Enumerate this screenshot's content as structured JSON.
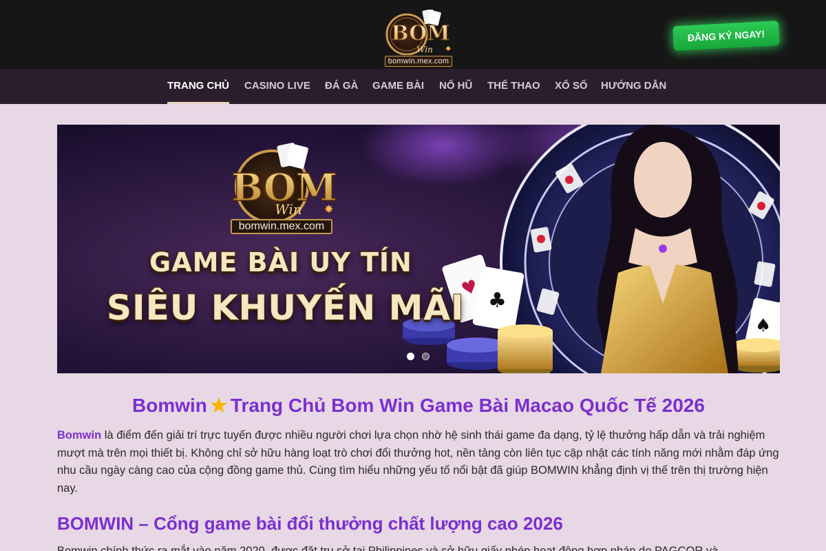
{
  "header": {
    "logo": {
      "wordmark": "BOM",
      "script": "Win",
      "domain": "bomwin.mex.com"
    },
    "register_button": "ĐĂNG KÝ NGAY!"
  },
  "nav": {
    "items": [
      {
        "label": "TRANG CHỦ",
        "active": true
      },
      {
        "label": "CASINO LIVE"
      },
      {
        "label": "ĐÁ GÀ"
      },
      {
        "label": "GAME BÀI"
      },
      {
        "label": "NỔ HŨ"
      },
      {
        "label": "THỂ THAO"
      },
      {
        "label": "XỔ SỐ"
      },
      {
        "label": "HƯỚNG DẪN"
      }
    ]
  },
  "hero": {
    "logo": {
      "wordmark": "BOM",
      "script": "Win",
      "domain": "bomwin.mex.com"
    },
    "line1": "GAME BÀI UY TÍN",
    "line2": "SIÊU KHUYẾN MÃI",
    "slides_total": 2,
    "active_slide": 1
  },
  "article": {
    "title_before": "Bomwin",
    "title_icon": "star-icon",
    "title_after": "Trang Chủ Bom Win Game Bài Macao Quốc Tế 2026",
    "intro_link": "Bomwin",
    "intro_rest": "là điểm đến giải trí trực tuyến được nhiều người chơi lựa chọn nhờ hệ sinh thái game đa dạng, tỷ lệ thưởng hấp dẫn và trải nghiệm mượt mà trên mọi thiết bị. Không chỉ sở hữu hàng loạt trò chơi đổi thưởng hot, nền tảng còn liên tục cập nhật các tính năng mới nhằm đáp ứng nhu cầu ngày càng cao của cộng đồng game thủ. Cùng tìm hiểu những yếu tố nổi bật đã giúp BOMWIN khẳng định vị thế trên thị trường hiện nay.",
    "h2": "BOMWIN – Cổng game bài đổi thưởng chất lượng cao 2026",
    "next_paragraph": "Bomwin chính thức ra mắt vào năm 2020, được đặt trụ sở tại Philippines và sở hữu giấy phép hoạt động hợp pháp do PAGCOR và"
  },
  "colors": {
    "page_bg": "#e8d7e4",
    "header_bg": "#161616",
    "nav_bg": "#2b1e2c",
    "accent_purple": "#7a2fd1",
    "cta_green": "#1fb244"
  }
}
